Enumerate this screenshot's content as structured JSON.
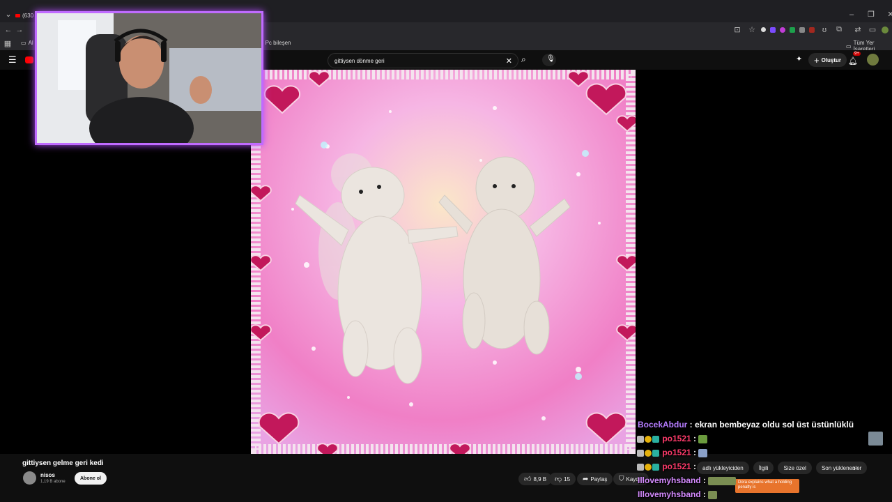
{
  "browser": {
    "tab_title": "(630",
    "bookmark_pc": "Pc bileşen",
    "bookmark_all": "Tüm Yer İşaretleri",
    "bookmark_left": "Al"
  },
  "youtube": {
    "search_query": "gittiysen dönme geri",
    "create_label": "Oluştur",
    "notif_count": "9+"
  },
  "video": {
    "title": "gittiysen gelme geri kedi",
    "channel": "nisos",
    "subscribers": "1,19 B abone",
    "subscribe_label": "Abone ol",
    "likes": "8,9 B",
    "dislikes": "15",
    "share_label": "Paylaş",
    "save_label": "Kaydet"
  },
  "chips": [
    "adlı yükleyiciden",
    "İlgili",
    "Size özel",
    "Son yüklenenler"
  ],
  "chat": [
    {
      "user": "BocekAbdur",
      "message": "ekran bembeyaz oldu sol üst üstünlüklü",
      "color": "#b57cff"
    },
    {
      "user": "po1521",
      "message": "",
      "color": "#ff3b6b"
    },
    {
      "user": "po1521",
      "message": "",
      "color": "#ff3b6b"
    },
    {
      "user": "po1521",
      "message": "",
      "color": "#ff3b6b"
    },
    {
      "user": "Illovemyhsband",
      "message": "",
      "color": "#d58bff"
    },
    {
      "user": "Illovemyhsband",
      "message": "",
      "color": "#d58bff"
    }
  ],
  "ad_text": "Dora explains what a holding penalty is",
  "colors": {
    "accent": "#ff0000",
    "cam_border": "#c06bff"
  }
}
